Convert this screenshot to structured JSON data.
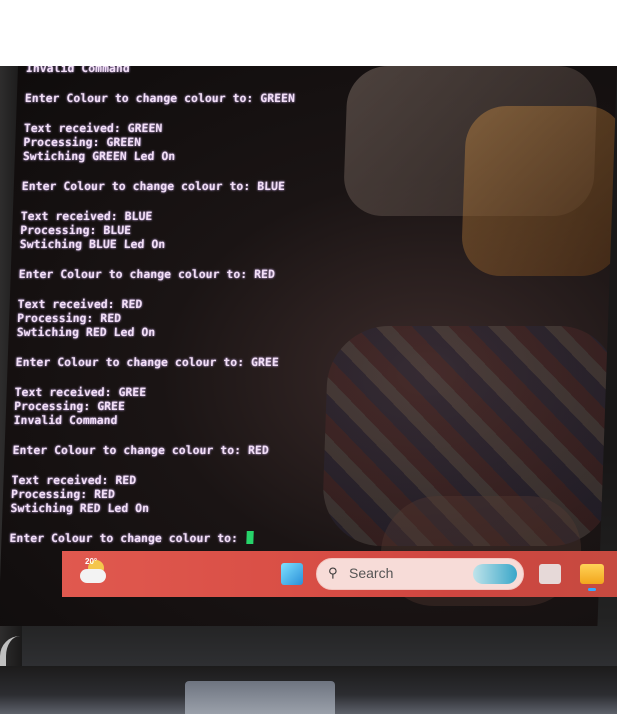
{
  "terminal": {
    "lines": [
      "Invalid Command",
      "",
      "Enter Colour to change colour to: GREEN",
      "",
      "Text received: GREEN",
      "Processing: GREEN",
      "Swtiching GREEN Led On",
      "",
      "Enter Colour to change colour to: BLUE",
      "",
      "Text received: BLUE",
      "Processing: BLUE",
      "Swtiching BLUE Led On",
      "",
      "Enter Colour to change colour to: RED",
      "",
      "Text received: RED",
      "Processing: RED",
      "Swtiching RED Led On",
      "",
      "Enter Colour to change colour to: GREE",
      "",
      "Text received: GREE",
      "Processing: GREE",
      "Invalid Command",
      "",
      "Enter Colour to change colour to: RED",
      "",
      "Text received: RED",
      "Processing: RED",
      "Swtiching RED Led On",
      "",
      "Enter Colour to change colour to: "
    ],
    "cursor_color": "#27d36a",
    "text_color": "#f2dff5"
  },
  "taskbar": {
    "weather_temp": "20°",
    "search_label": "Search",
    "weather_icon": "weather-partly-cloudy-icon",
    "start_icon": "windows-start-icon",
    "search_icon": "search-icon",
    "task_view_icon": "task-view-icon",
    "file_explorer_icon": "folder-icon",
    "accent": "#d94f46"
  }
}
